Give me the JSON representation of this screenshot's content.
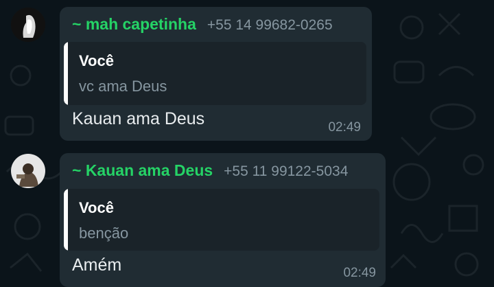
{
  "messages": [
    {
      "sender_name": "~ mah capetinha",
      "sender_phone": "+55 14 99682-0265",
      "quote_author": "Você",
      "quote_text": "vc ama Deus",
      "text": "Kauan ama Deus",
      "time": "02:49"
    },
    {
      "sender_name": "~ Kauan ama Deus",
      "sender_phone": "+55 11 99122-5034",
      "quote_author": "Você",
      "quote_text": "benção",
      "text": "Amém",
      "time": "02:49"
    }
  ],
  "colors": {
    "background": "#0b141a",
    "bubble": "#202c33",
    "quote_bg": "#1a2329",
    "sender_name": "#25d366",
    "muted": "#8696a0",
    "text": "#e9edef"
  }
}
